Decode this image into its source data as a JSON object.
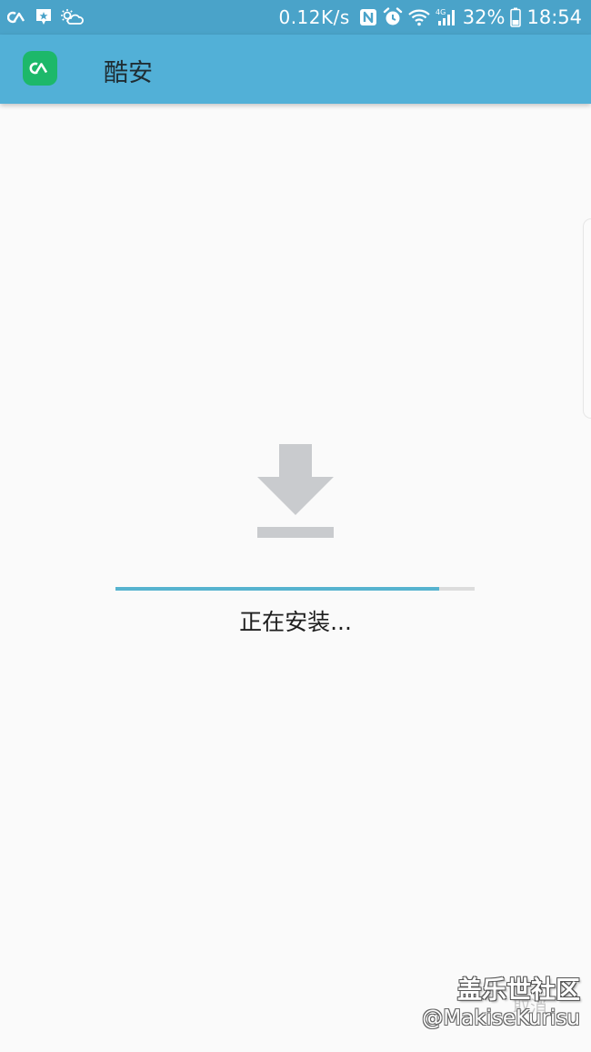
{
  "status_bar": {
    "left_icons": [
      "coolapk-icon",
      "notification-icon",
      "weather-icon"
    ],
    "network_speed": "0.12K/s",
    "right_icons": [
      "nfc-icon",
      "alarm-icon",
      "wifi-icon",
      "signal-4g-icon",
      "battery-icon"
    ],
    "battery_percent": "32%",
    "time": "18:54",
    "color": "#4aa3c9"
  },
  "app_bar": {
    "title": "酷安",
    "logo_icon": "coolapk-logo-icon",
    "color": "#52b0d7",
    "logo_color": "#1db86a"
  },
  "install": {
    "icon": "download-icon",
    "progress": 0.9,
    "status_text": "正在安装...",
    "progress_color": "#56b3cf"
  },
  "footer": {
    "cancel_label": "取消"
  },
  "watermark": {
    "community": "盖乐世社区",
    "user": "@MakiseKurisu"
  }
}
